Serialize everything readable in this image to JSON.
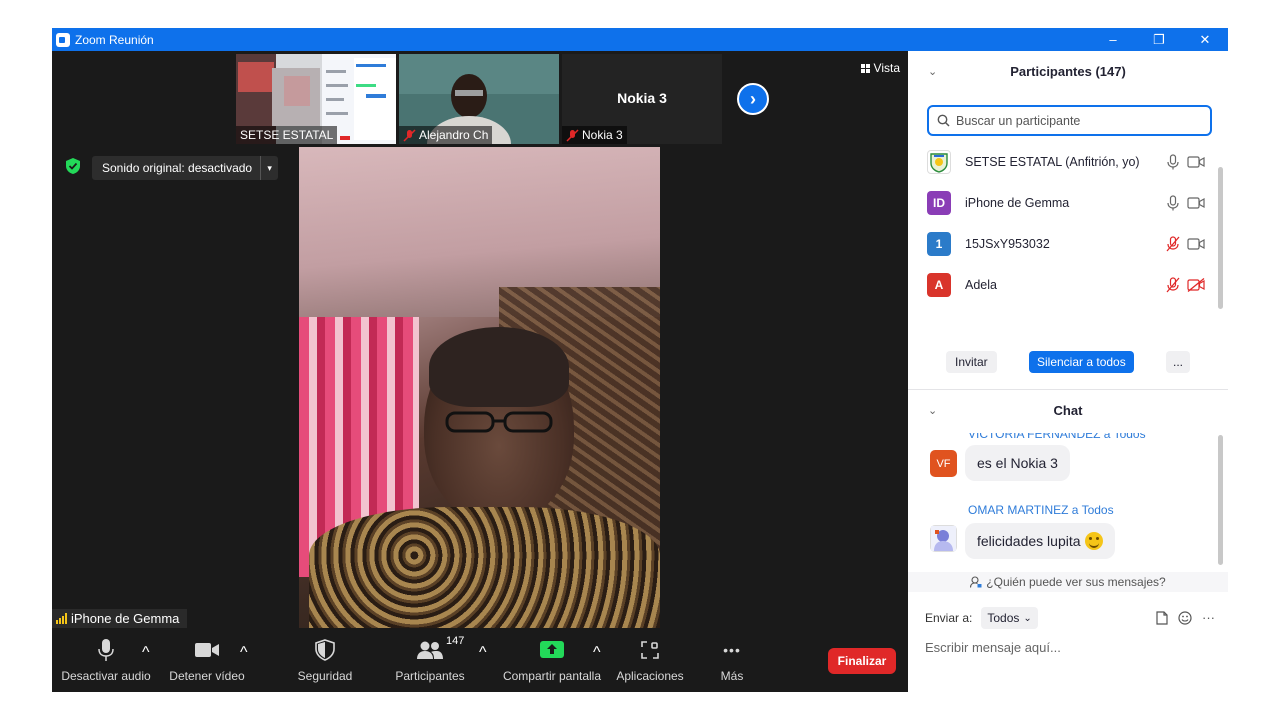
{
  "window": {
    "title": "Zoom Reunión",
    "minimize": "–",
    "restore": "❐",
    "close": "✕"
  },
  "view": {
    "label": "Vista"
  },
  "thumbnails": [
    {
      "name": "SETSE ESTATAL",
      "muted": false
    },
    {
      "name": "Alejandro Ch",
      "muted": true
    },
    {
      "name": "Nokia 3",
      "muted": true,
      "display_name": "Nokia 3"
    }
  ],
  "next_arrow": "›",
  "sound": {
    "label": "Sonido original: desactivado",
    "caret": "▾"
  },
  "active_speaker": {
    "name": "iPhone de Gemma"
  },
  "toolbar": {
    "audio": "Desactivar audio",
    "video": "Detener vídeo",
    "security": "Seguridad",
    "participants": "Participantes",
    "participants_count": "147",
    "share": "Compartir pantalla",
    "apps": "Aplicaciones",
    "more": "Más",
    "more_glyph": "•••",
    "end": "Finalizar",
    "caret": "^"
  },
  "participants_panel": {
    "title": "Participantes (147)",
    "collapse": "⌄",
    "search_placeholder": "Buscar un participante",
    "list": [
      {
        "name": "SETSE ESTATAL (Anfitrión, yo)",
        "avatar": "",
        "avatar_color": "#ffffff",
        "mic_muted": false,
        "cam_off": false
      },
      {
        "name": "iPhone de Gemma",
        "avatar": "ID",
        "avatar_color": "#8a3db6",
        "mic_muted": false,
        "cam_off": false
      },
      {
        "name": "15JSxY953032",
        "avatar": "1",
        "avatar_color": "#2b7bc9",
        "mic_muted": true,
        "cam_off": false
      },
      {
        "name": "Adela",
        "avatar": "A",
        "avatar_color": "#d9342b",
        "mic_muted": true,
        "cam_off": true
      }
    ],
    "invite": "Invitar",
    "mute_all": "Silenciar a todos",
    "more": "..."
  },
  "chat": {
    "title": "Chat",
    "collapse": "⌄",
    "messages": [
      {
        "sender": "VICTORIA FERNANDEZ a Todos",
        "text": "es el Nokia 3",
        "avatar": "VF",
        "avatar_color": "#e0531f"
      },
      {
        "sender": "OMAR MARTINEZ a Todos",
        "text": "felicidades lupita",
        "avatar": "",
        "avatar_color": "#7a7fd8"
      }
    ],
    "who_can_see": "¿Quién puede ver sus mensajes?",
    "send_to_label": "Enviar a:",
    "send_to_value": "Todos",
    "send_to_caret": "⌄",
    "input_placeholder": "Escribir mensaje aquí...",
    "more_glyph": "···"
  }
}
